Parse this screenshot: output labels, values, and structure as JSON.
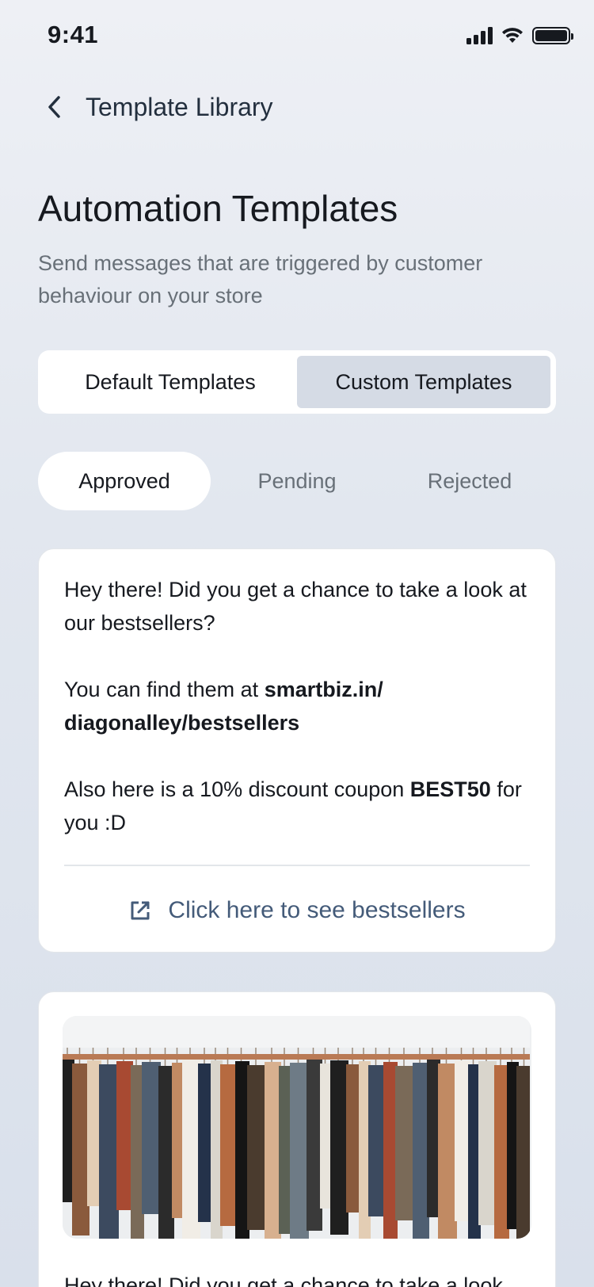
{
  "status": {
    "time": "9:41"
  },
  "header": {
    "title": "Template Library"
  },
  "page": {
    "title": "Automation Templates",
    "subtitle": "Send messages that are triggered by customer behaviour on your store"
  },
  "segments": [
    {
      "label": "Default Templates",
      "active": false
    },
    {
      "label": "Custom Templates",
      "active": true
    }
  ],
  "filters": [
    {
      "label": "Approved",
      "active": true
    },
    {
      "label": "Pending",
      "active": false
    },
    {
      "label": "Rejected",
      "active": false
    }
  ],
  "cards": [
    {
      "line1": "Hey there! Did you get a chance to take a look at our bestsellers?",
      "line2_prefix": "You can find them at ",
      "line2_link": "smartbiz.in/ diagonalley/bestsellers",
      "line3_prefix": "Also here is a 10% discount coupon ",
      "line3_code": "BEST50",
      "line3_suffix": " for you :D",
      "cta_label": "Click here to see bestsellers"
    },
    {
      "line1": "Hey there! Did you get a chance to take a look"
    }
  ],
  "colors": {
    "accent": "#445b79",
    "active_segment": "#d5dbe5",
    "muted_text": "#687078"
  },
  "icons": {
    "back": "chevron-left-icon",
    "cta": "external-link-icon"
  }
}
